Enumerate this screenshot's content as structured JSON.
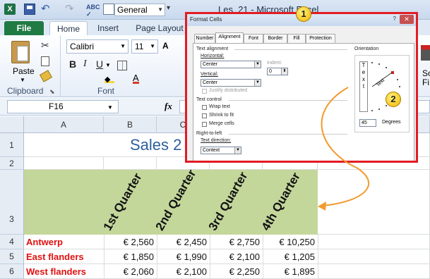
{
  "titlebar": {
    "app_icon": "X",
    "font_value": "General",
    "window_title": "Les_21  -  Microsoft Excel",
    "icons": [
      "excel-app-icon",
      "save-icon",
      "undo-icon",
      "redo-icon",
      "spelling-icon",
      "format-icon"
    ]
  },
  "tabs": {
    "file": "File",
    "home": "Home",
    "insert": "Insert",
    "page_layout": "Page Layout"
  },
  "ribbon": {
    "clipboard": {
      "paste": "Paste",
      "label": "Clipboard"
    },
    "font": {
      "name": "Calibri",
      "size": "11",
      "label": "Font",
      "bold": "B",
      "italic": "I",
      "underline": "U",
      "grow": "A",
      "color": "A"
    },
    "sort": {
      "label": "So\nFi"
    }
  },
  "formula_bar": {
    "name_box": "F16",
    "fx": "fx",
    "formula": ""
  },
  "sheet": {
    "columns": [
      "A",
      "B",
      "C"
    ],
    "rows": [
      "1",
      "2",
      "3",
      "4",
      "5",
      "6"
    ],
    "title": "Sales 2",
    "quarters": [
      "1st Quarter",
      "2nd Quarter",
      "3rd Quarter",
      "4th Quarter"
    ],
    "data": [
      {
        "city": "Antwerp",
        "values": [
          "€ 2,560",
          "€ 2,450",
          "€ 2,750",
          "€ 10,250"
        ]
      },
      {
        "city": "East flanders",
        "values": [
          "€ 1,850",
          "€ 1,990",
          "€ 2,100",
          "€ 1,205"
        ]
      },
      {
        "city": "West flanders",
        "values": [
          "€ 2,060",
          "€ 2,100",
          "€ 2,250",
          "€ 1,895"
        ]
      }
    ]
  },
  "dialog": {
    "title": "Format Cells",
    "help": "?",
    "close": "✕",
    "tabs": [
      "Number",
      "Alignment",
      "Font",
      "Border",
      "Fill",
      "Protection"
    ],
    "active_tab": "Alignment",
    "text_alignment": {
      "section": "Text alignment",
      "horizontal_label": "Horizontal:",
      "horizontal_value": "Center",
      "indent_label": "Indent:",
      "indent_value": "0",
      "vertical_label": "Vertical:",
      "vertical_value": "Center",
      "justify_distributed": "Justify distributed"
    },
    "text_control": {
      "section": "Text control",
      "wrap": "Wrap text",
      "shrink": "Shrink to fit",
      "merge": "Merge cells"
    },
    "rtl": {
      "section": "Right-to-left",
      "direction_label": "Text direction:",
      "direction_value": "Context"
    },
    "orientation": {
      "section": "Orientation",
      "vertical_text": "T\ne\nx\nt",
      "dial_text": "Text",
      "degrees_value": "45",
      "degrees_label": "Degrees"
    }
  },
  "callouts": {
    "one": "1",
    "two": "2"
  },
  "colors": {
    "accent_red": "#e21c24",
    "file_green": "#1f7a44",
    "header_green": "#c4d79b",
    "city_red": "#e01010",
    "callout_yellow": "#f0b400",
    "arrow_orange": "#f29a2e"
  }
}
